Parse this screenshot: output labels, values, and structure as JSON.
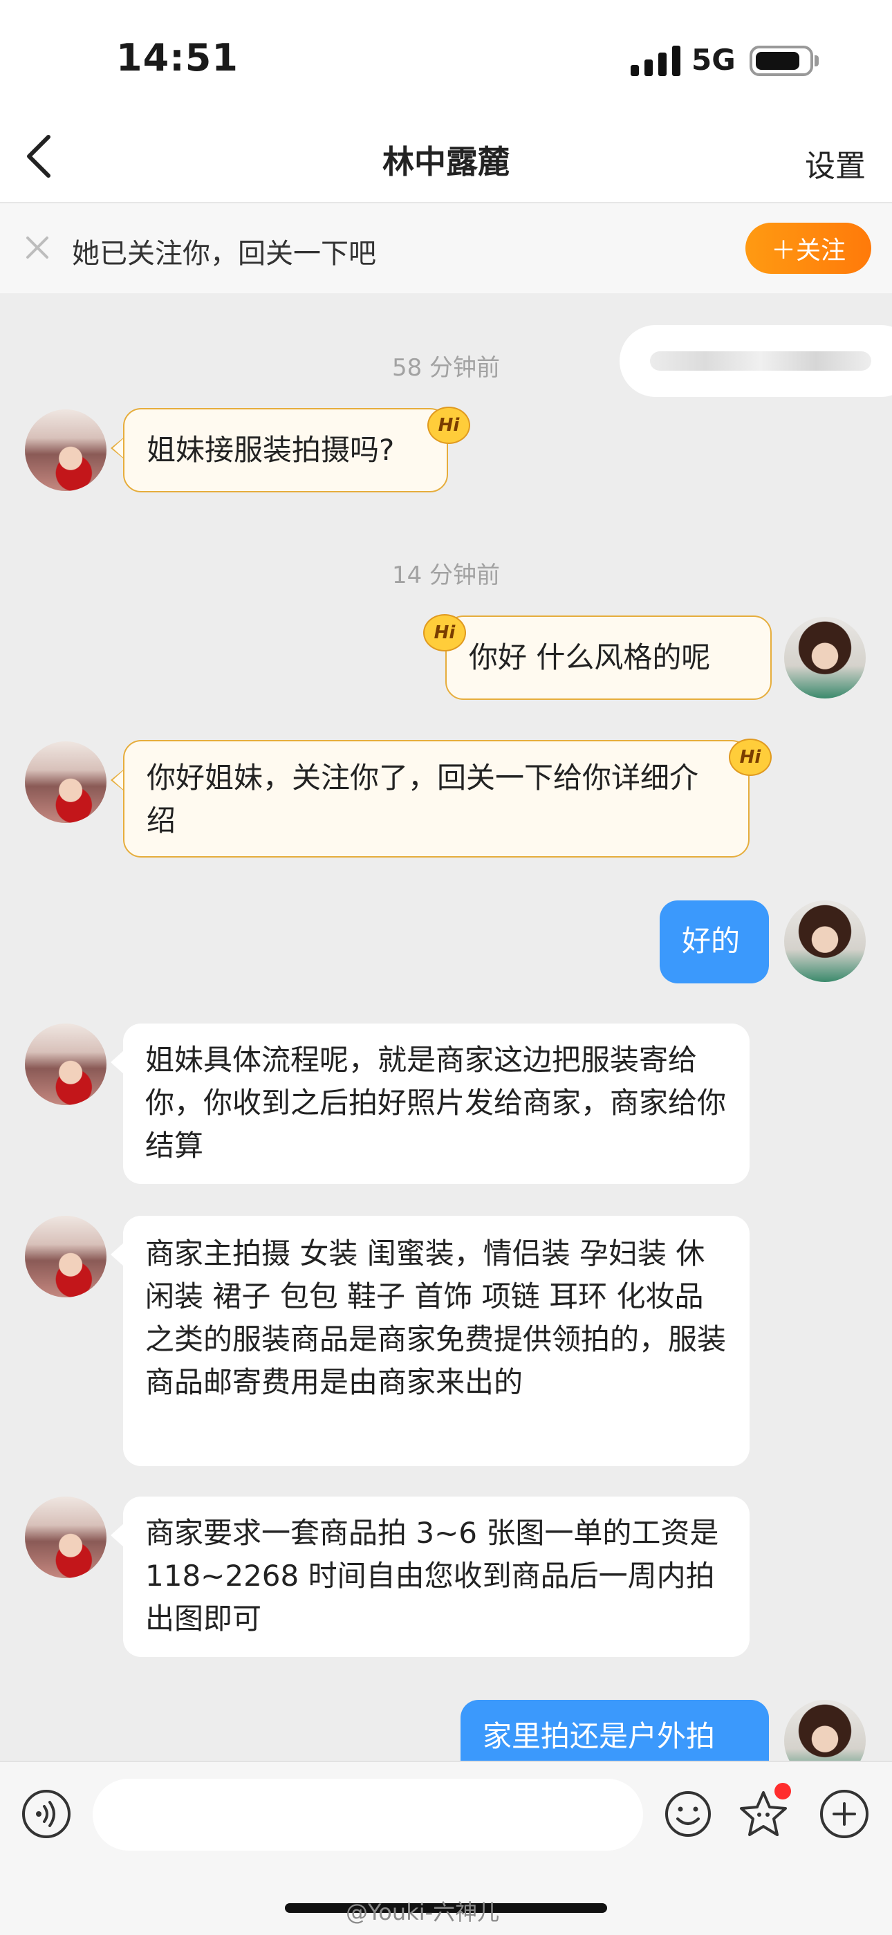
{
  "status_bar": {
    "time": "14:51",
    "network": "5G",
    "battery_level": 0.85
  },
  "nav": {
    "title": "林中露麓",
    "settings_label": "设置"
  },
  "banner": {
    "text": "她已关注你，回关一下吧",
    "follow_label": "＋关注"
  },
  "hi_badge_label": "Hi",
  "messages": [
    {
      "type": "timestamp",
      "text": "58 分钟前"
    },
    {
      "side": "left",
      "style": "hi",
      "text": "姐妹接服装拍摄吗?"
    },
    {
      "type": "timestamp",
      "text": "14 分钟前"
    },
    {
      "side": "right",
      "style": "hi",
      "text": "你好  什么风格的呢"
    },
    {
      "side": "left",
      "style": "hi",
      "text": "你好姐妹，关注你了，回关一下给你详细介绍"
    },
    {
      "side": "right",
      "style": "blue",
      "text": "好的"
    },
    {
      "side": "left",
      "style": "white",
      "text": "姐妹具体流程呢，就是商家这边把服装寄给你，你收到之后拍好照片发给商家，商家给你结算"
    },
    {
      "side": "left",
      "style": "white",
      "text": "商家主拍摄 女装 闺蜜装，情侣装 孕妇装  休闲装 裙子 包包 鞋子 首饰 项链 耳环 化妆品之类的服装商品是商家免费提供领拍的，服装商品邮寄费用是由商家来出的"
    },
    {
      "side": "left",
      "style": "white",
      "text": "商家要求一套商品拍 3~6 张图一单的工资是 118~2268 时间自由您收到商品后一周内拍出图即可"
    },
    {
      "side": "right",
      "style": "blue",
      "text": "家里拍还是户外拍"
    }
  ],
  "input": {
    "placeholder": ""
  },
  "watermark": "@Youki-六神儿",
  "icons": [
    "back-icon",
    "close-icon",
    "voice-icon",
    "emoji-icon",
    "star-icon",
    "plus-icon"
  ]
}
